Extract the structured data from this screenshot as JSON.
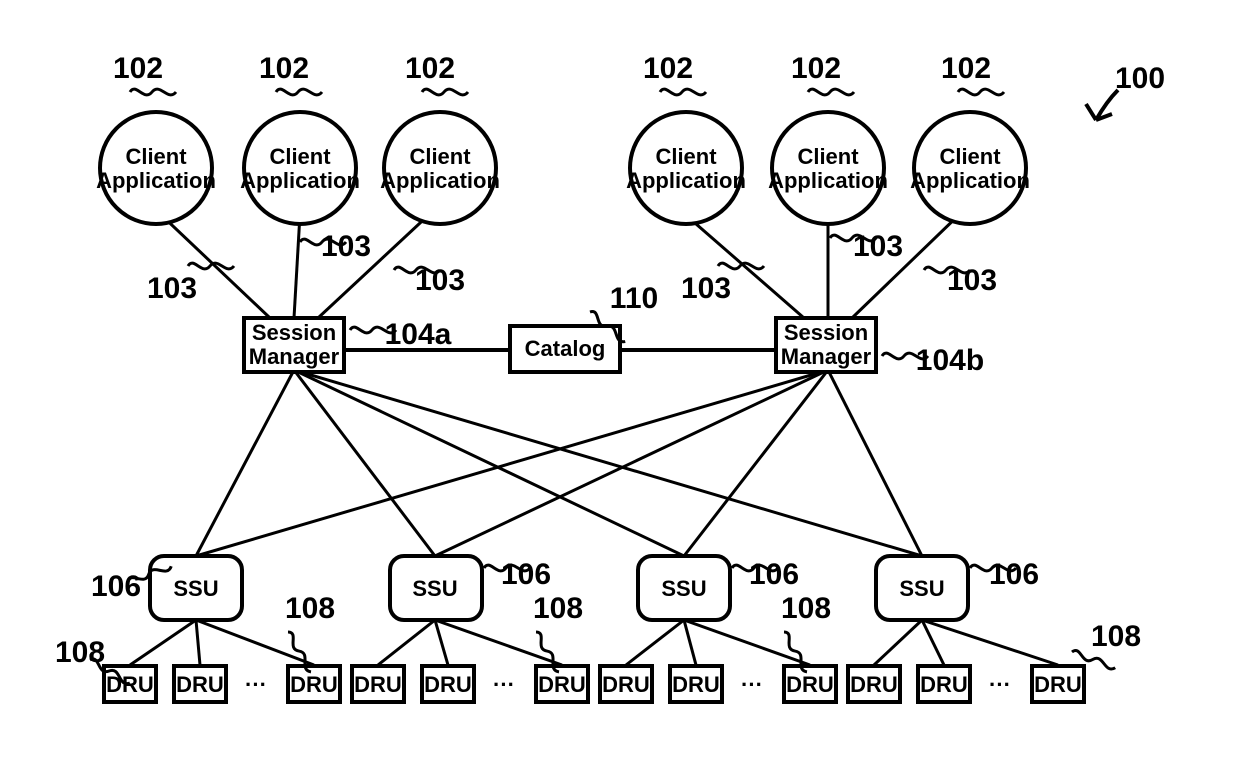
{
  "figure_ref": "100",
  "clients": {
    "label_line1": "Client",
    "label_line2": "Application",
    "ref": "102"
  },
  "conn_client_sm": {
    "ref": "103"
  },
  "session_manager": {
    "label_line1": "Session",
    "label_line2": "Manager",
    "ref_a": "104a",
    "ref_b": "104b"
  },
  "catalog": {
    "label": "Catalog",
    "ref": "110"
  },
  "ssu": {
    "label": "SSU",
    "ref": "106"
  },
  "dru": {
    "label": "DRU",
    "ref": "108"
  },
  "ellipsis": "···"
}
